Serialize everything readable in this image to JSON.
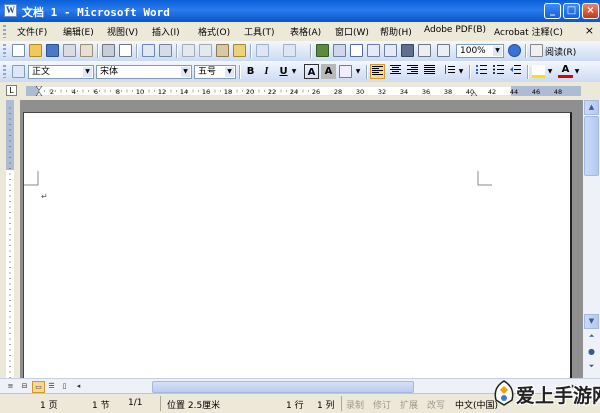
{
  "window": {
    "title": "文档 1 - Microsoft Word",
    "icon_letter": "W",
    "controls": {
      "minimize": "_",
      "maximize": "□",
      "close": "×"
    }
  },
  "menu": {
    "items": [
      {
        "label": "文件(F)"
      },
      {
        "label": "编辑(E)"
      },
      {
        "label": "视图(V)"
      },
      {
        "label": "插入(I)"
      },
      {
        "label": "格式(O)"
      },
      {
        "label": "工具(T)"
      },
      {
        "label": "表格(A)"
      },
      {
        "label": "窗口(W)"
      },
      {
        "label": "帮助(H)"
      },
      {
        "label": "Adobe PDF(B)"
      },
      {
        "label": "Acrobat 注释(C)"
      }
    ],
    "close_doc": "×"
  },
  "standard_toolbar": {
    "zoom_value": "100%",
    "reading_label": "阅读(R)"
  },
  "formatting_toolbar": {
    "style_value": "正文",
    "font_value": "宋体",
    "size_value": "五号",
    "bold": "B",
    "italic": "I",
    "underline": "U",
    "char_border": "A",
    "char_shading": "A"
  },
  "ruler": {
    "corner": "L",
    "tick_labels": [
      "2",
      "4",
      "6",
      "8",
      "10",
      "12",
      "14",
      "16",
      "18",
      "20",
      "22",
      "24",
      "26",
      "28",
      "30",
      "32",
      "34",
      "36",
      "38",
      "40",
      "42",
      "44",
      "46",
      "48"
    ]
  },
  "document": {
    "paragraph_mark": "↵"
  },
  "status": {
    "page": "1 页",
    "section": "1 节",
    "page_of": "1/1",
    "position": "位置 2.5厘米",
    "line": "1 行",
    "column": "1 列",
    "rec": "录制",
    "trk": "修订",
    "ext": "扩展",
    "ovr": "改写",
    "language": "中文(中国)"
  },
  "watermark": {
    "text": "爱上手游网"
  },
  "colors": {
    "titlebar": "#0a5fd8",
    "toolbar": "#cbdaf3",
    "workspace": "#8f8f8f",
    "highlight": "#f8d792"
  }
}
